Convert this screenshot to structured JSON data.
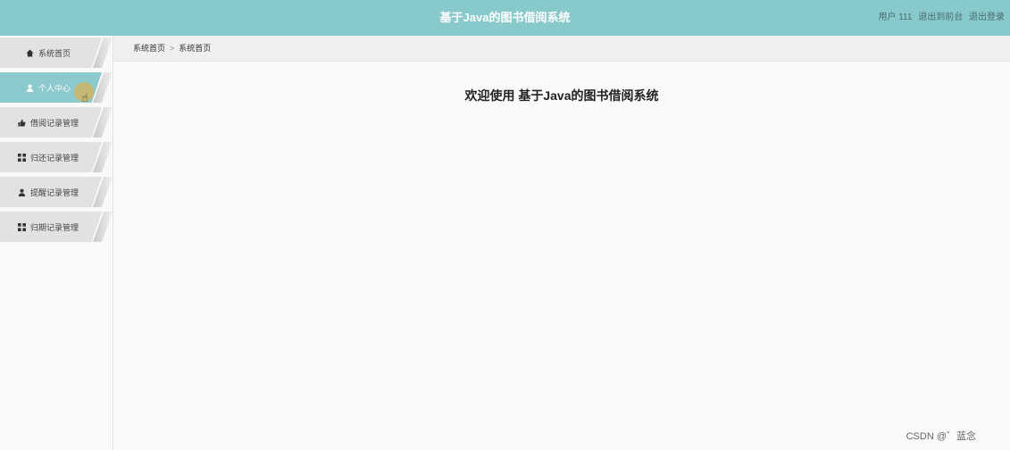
{
  "header": {
    "title": "基于Java的图书借阅系统",
    "user": "用户 111",
    "back_label": "退出到前台",
    "logout_label": "退出登录"
  },
  "sidebar": {
    "items": [
      {
        "label": "系统首页",
        "icon": "home-icon"
      },
      {
        "label": "个人中心",
        "icon": "user-icon"
      },
      {
        "label": "借阅记录管理",
        "icon": "thumbs-up-icon"
      },
      {
        "label": "归还记录管理",
        "icon": "grid-icon"
      },
      {
        "label": "提醒记录管理",
        "icon": "user-icon"
      },
      {
        "label": "归期记录管理",
        "icon": "grid-icon"
      }
    ],
    "active_index": 1
  },
  "breadcrumb": {
    "root": "系统首页",
    "current": "系统首页"
  },
  "main": {
    "welcome": "欢迎使用 基于Java的图书借阅系统"
  },
  "watermark": "CSDN @゛蓝念"
}
